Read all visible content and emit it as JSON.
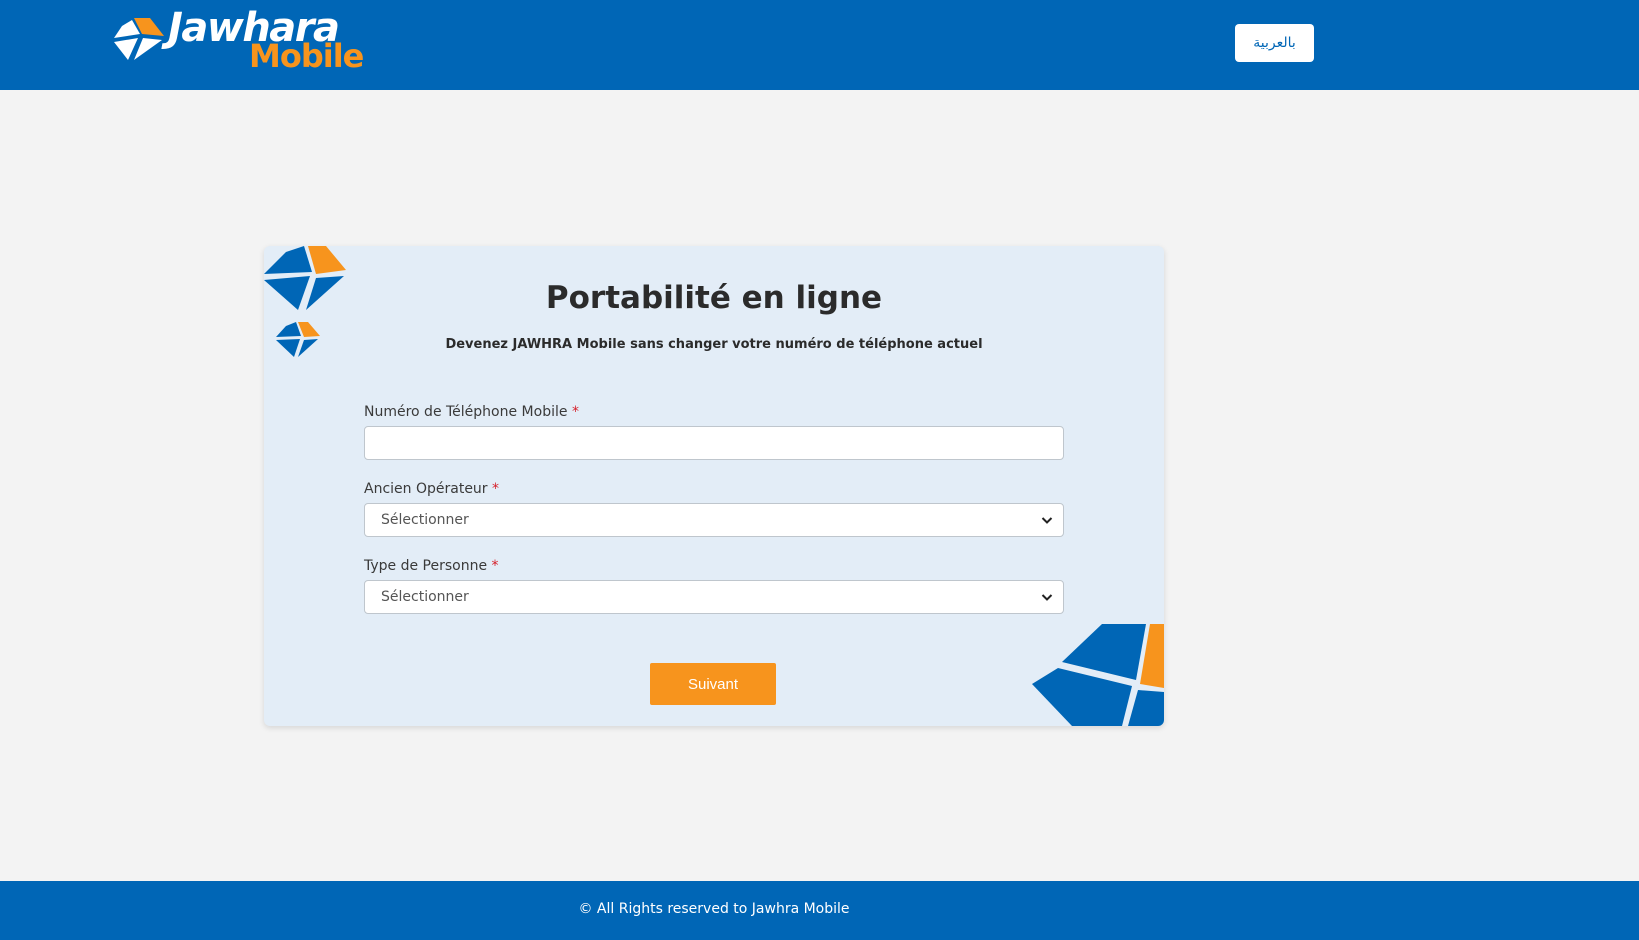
{
  "header": {
    "logo": {
      "word": "Jawhara",
      "sub": "Mobile"
    },
    "language_button": "بالعربية"
  },
  "form": {
    "title": "Portabilité en ligne",
    "subtitle": "Devenez JAWHRA Mobile sans changer votre numéro de téléphone actuel",
    "required_marker": "*",
    "fields": [
      {
        "label": "Numéro de Téléphone Mobile",
        "value": "",
        "placeholder": ""
      },
      {
        "label": "Ancien Opérateur",
        "selected": "Sélectionner"
      },
      {
        "label": "Type de Personne",
        "selected": "Sélectionner"
      }
    ],
    "submit_label": "Suivant"
  },
  "footer": {
    "text": "© All Rights reserved to Jawhra Mobile"
  },
  "colors": {
    "brand_blue": "#0066b6",
    "brand_orange": "#f7941d",
    "card_bg": "#e3edf7",
    "page_bg": "#f3f3f3",
    "required_red": "#d6202a"
  },
  "icons": {
    "logo_mark": "diamond-logo-icon",
    "select_arrow": "chevron-down-icon"
  }
}
